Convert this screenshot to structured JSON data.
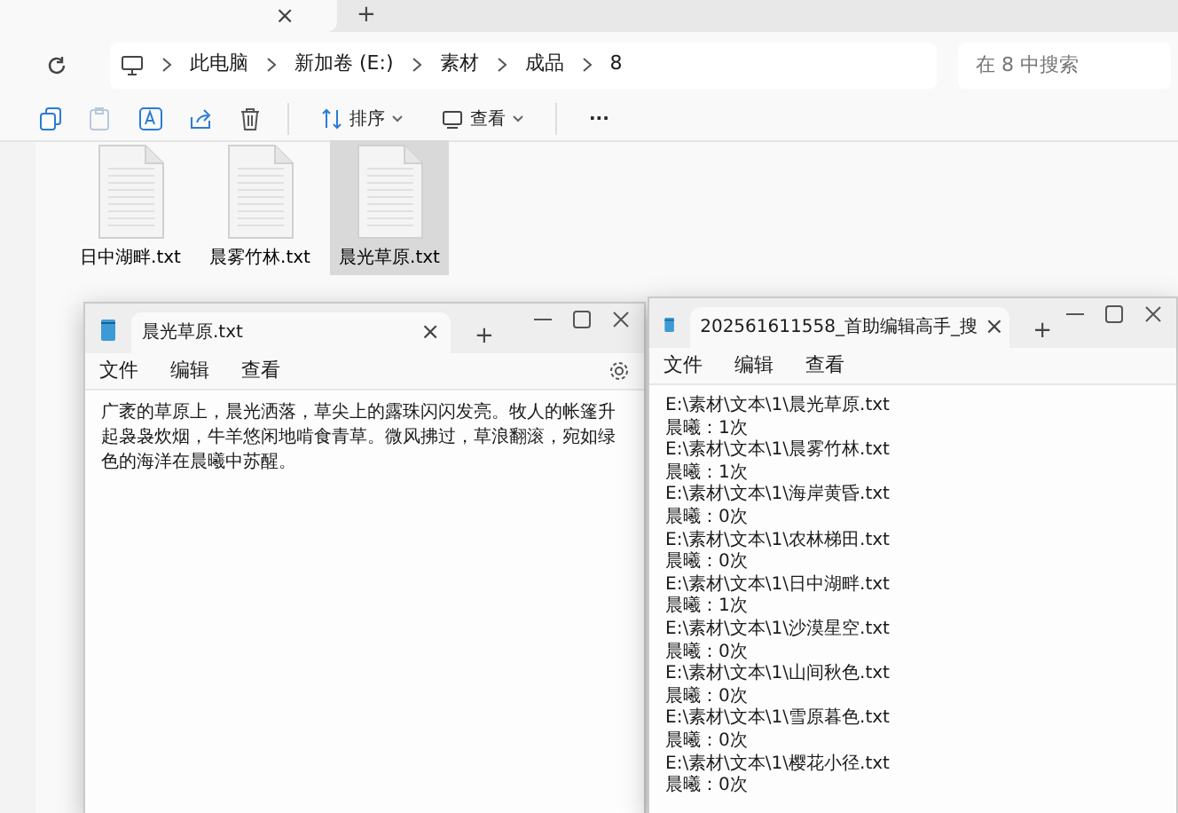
{
  "explorer": {
    "tab_close": "×",
    "tab_add": "+",
    "breadcrumb": [
      "此电脑",
      "新加卷 (E:)",
      "素材",
      "成品",
      "8"
    ],
    "search": {
      "placeholder": "在 8 中搜索"
    },
    "toolbar": {
      "sort": "排序",
      "view": "查看",
      "more": "···"
    },
    "files": [
      {
        "name": "日中湖畔.txt",
        "selected": false
      },
      {
        "name": "晨雾竹林.txt",
        "selected": false
      },
      {
        "name": "晨光草原.txt",
        "selected": true
      }
    ]
  },
  "windows": [
    {
      "title": "晨光草原.txt",
      "tab_close": "×",
      "tab_add": "+",
      "menu": [
        "文件",
        "编辑",
        "查看"
      ],
      "settings": true,
      "lines": [
        "广袤的草原上，晨光洒落，草尖上的露珠闪闪发亮。牧人的帐篷升起袅袅炊烟，牛羊悠闲地啃食青草。微风拂过，草浪翻滚，宛如绿色的海洋在晨曦中苏醒。"
      ]
    },
    {
      "title": "202561611558_首助编辑高手_搜",
      "tab_close": "×",
      "tab_add": "+",
      "menu": [
        "文件",
        "编辑",
        "查看"
      ],
      "settings": false,
      "lines": [
        "E:\\素材\\文本\\1\\晨光草原.txt",
        "晨曦：1次",
        "E:\\素材\\文本\\1\\晨雾竹林.txt",
        "晨曦：1次",
        "E:\\素材\\文本\\1\\海岸黄昏.txt",
        "晨曦：0次",
        "E:\\素材\\文本\\1\\农林梯田.txt",
        "晨曦：0次",
        "E:\\素材\\文本\\1\\日中湖畔.txt",
        "晨曦：1次",
        "E:\\素材\\文本\\1\\沙漠星空.txt",
        "晨曦：0次",
        "E:\\素材\\文本\\1\\山间秋色.txt",
        "晨曦：0次",
        "E:\\素材\\文本\\1\\雪原暮色.txt",
        "晨曦：0次",
        "E:\\素材\\文本\\1\\樱花小径.txt",
        "晨曦：0次"
      ]
    }
  ]
}
